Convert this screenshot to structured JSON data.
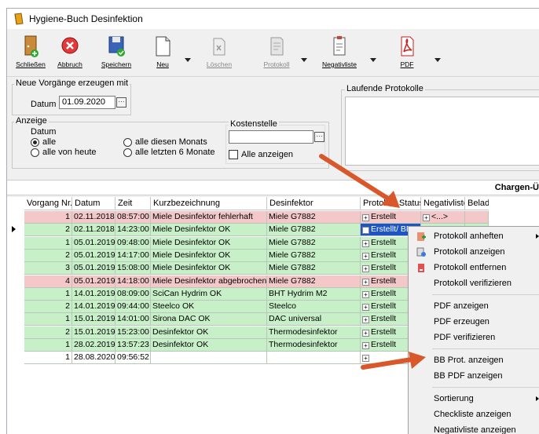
{
  "window": {
    "title": "Hygiene-Buch Desinfektion"
  },
  "toolbar": {
    "close": "Schließen",
    "abort": "Abbruch",
    "save": "Speichern",
    "new": "Neu",
    "delete": "Löschen",
    "protocol": "Protokoll",
    "negativelist": "Negativliste",
    "pdf": "PDF"
  },
  "neue": {
    "legend": "Neue Vorgänge erzeugen mit",
    "date_label": "Datum",
    "date_value": "01.09.2020"
  },
  "anzeige": {
    "legend": "Anzeige",
    "datum_legend": "Datum",
    "radios": [
      "alle",
      "alle von heute",
      "alle diesen Monats",
      "alle letzten 6 Monate"
    ],
    "kosten_legend": "Kostenstelle",
    "kosten_value": "",
    "alle_anzeigen": "Alle anzeigen"
  },
  "laufende": {
    "legend": "Laufende Protokolle"
  },
  "chargen": {
    "label": "Chargen-Ü"
  },
  "columns": [
    "Vorgang Nr.",
    "Datum",
    "Zeit",
    "Kurzbezeichnung",
    "Desinfektor",
    "Protokoll Status",
    "Negativliste",
    "Belade"
  ],
  "rows": [
    {
      "nr": "1",
      "datum": "02.11.2018",
      "zeit": "08:57:00",
      "kurz": "Miele Desinfektor fehlerhaft",
      "des": "Miele G7882",
      "status": "Erstellt",
      "neg": "<...>"
    },
    {
      "nr": "2",
      "datum": "02.11.2018",
      "zeit": "14:23:00",
      "kurz": "Miele Desinfektor OK",
      "des": "Miele G7882",
      "status": "Erstellt/ BB-Erstellt",
      "neg": "<...>"
    },
    {
      "nr": "1",
      "datum": "05.01.2019",
      "zeit": "09:48:00",
      "kurz": "Miele Desinfektor OK",
      "des": "Miele G7882",
      "status": "Erstellt",
      "neg": ""
    },
    {
      "nr": "2",
      "datum": "05.01.2019",
      "zeit": "14:17:00",
      "kurz": "Miele Desinfektor OK",
      "des": "Miele G7882",
      "status": "Erstellt",
      "neg": ""
    },
    {
      "nr": "3",
      "datum": "05.01.2019",
      "zeit": "15:08:00",
      "kurz": "Miele Desinfektor OK",
      "des": "Miele G7882",
      "status": "Erstellt",
      "neg": ""
    },
    {
      "nr": "4",
      "datum": "05.01.2019",
      "zeit": "14:18:00",
      "kurz": "Miele Desinfektor abgebrochen",
      "des": "Miele G7882",
      "status": "Erstellt",
      "neg": ""
    },
    {
      "nr": "1",
      "datum": "14.01.2019",
      "zeit": "08:09:00",
      "kurz": "SciCan Hydrim OK",
      "des": "BHT Hydrim M2",
      "status": "Erstellt",
      "neg": ""
    },
    {
      "nr": "2",
      "datum": "14.01.2019",
      "zeit": "09:44:00",
      "kurz": "Steelco OK",
      "des": "Steelco",
      "status": "Erstellt",
      "neg": ""
    },
    {
      "nr": "1",
      "datum": "15.01.2019",
      "zeit": "14:01:00",
      "kurz": "Sirona DAC OK",
      "des": "DAC universal",
      "status": "Erstellt",
      "neg": ""
    },
    {
      "nr": "2",
      "datum": "15.01.2019",
      "zeit": "15:23:00",
      "kurz": "Desinfektor OK",
      "des": "Thermodesinfektor",
      "status": "Erstellt",
      "neg": ""
    },
    {
      "nr": "1",
      "datum": "28.02.2019",
      "zeit": "13:57:23",
      "kurz": "Desinfektor OK",
      "des": "Thermodesinfektor",
      "status": "Erstellt",
      "neg": ""
    },
    {
      "nr": "1",
      "datum": "28.08.2020",
      "zeit": "09:56:52",
      "kurz": "",
      "des": "",
      "status": "",
      "neg": ""
    }
  ],
  "menu": [
    "Protokoll anheften",
    "Protokoll anzeigen",
    "Protokoll entfernen",
    "Protokoll verifizieren",
    "PDF anzeigen",
    "PDF erzeugen",
    "PDF verifizieren",
    "BB Prot. anzeigen",
    "BB PDF anzeigen",
    "Sortierung",
    "Checkliste anzeigen",
    "Negativliste anzeigen"
  ],
  "colors": {
    "row_green": "#c8f0c8",
    "row_red": "#f4c8c8",
    "arrow": "#d9582b"
  }
}
